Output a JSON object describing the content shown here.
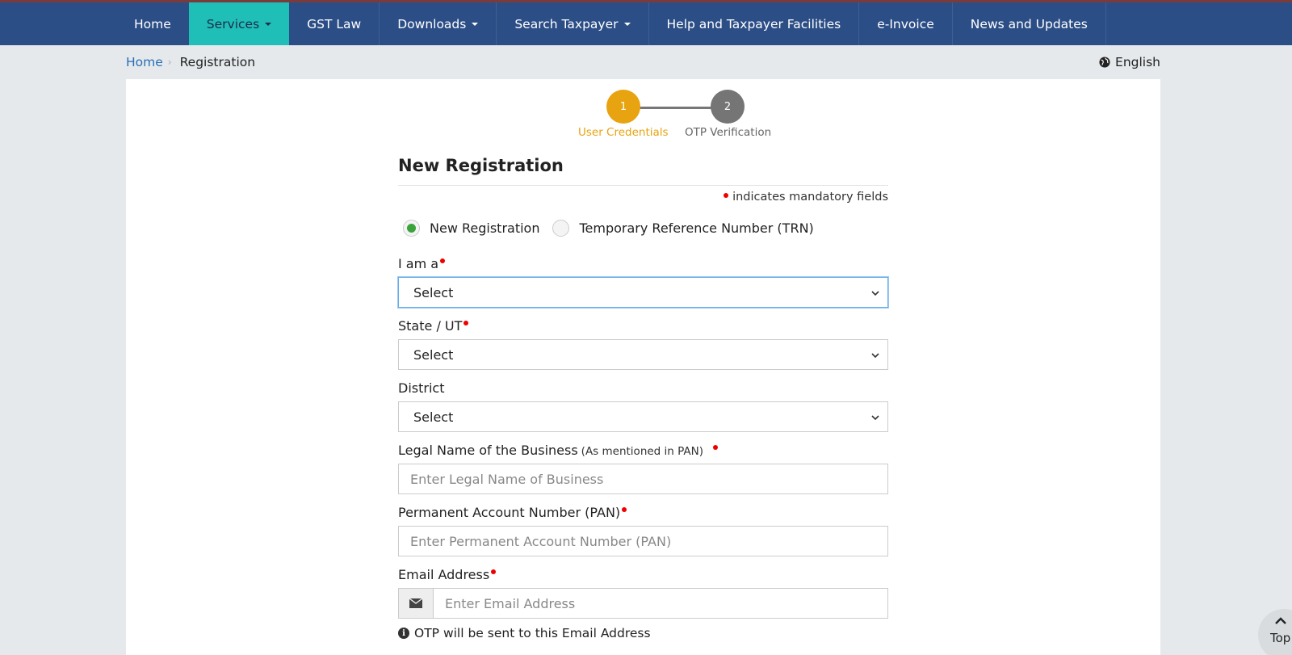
{
  "nav": {
    "items": [
      {
        "label": "Home",
        "dropdown": false
      },
      {
        "label": "Services",
        "dropdown": true,
        "active": true
      },
      {
        "label": "GST Law",
        "dropdown": false
      },
      {
        "label": "Downloads",
        "dropdown": true
      },
      {
        "label": "Search Taxpayer",
        "dropdown": true
      },
      {
        "label": "Help and Taxpayer Facilities",
        "dropdown": false
      },
      {
        "label": "e-Invoice",
        "dropdown": false
      },
      {
        "label": "News and Updates",
        "dropdown": false
      }
    ]
  },
  "breadcrumb": {
    "home": "Home",
    "current": "Registration"
  },
  "language": {
    "label": "English",
    "icon": "globe-icon"
  },
  "stepper": {
    "steps": [
      {
        "number": "1",
        "label": "User Credentials",
        "state": "active",
        "color": "#e8a310"
      },
      {
        "number": "2",
        "label": "OTP Verification",
        "state": "pending",
        "color": "#757575"
      }
    ]
  },
  "form": {
    "title": "New Registration",
    "mandatory_note": "indicates mandatory fields",
    "radio": {
      "options": [
        "New Registration",
        "Temporary Reference Number (TRN)"
      ],
      "selected": "New Registration"
    },
    "i_am_a": {
      "label": "I am a",
      "value": "Select"
    },
    "state": {
      "label": "State / UT",
      "value": "Select"
    },
    "district": {
      "label": "District",
      "value": "Select"
    },
    "legal_name": {
      "label": "Legal Name of the Business",
      "sub": "(As mentioned in PAN)",
      "placeholder": "Enter Legal Name of Business"
    },
    "pan": {
      "label": "Permanent Account Number (PAN)",
      "placeholder": "Enter Permanent Account Number (PAN)"
    },
    "email": {
      "label": "Email Address",
      "placeholder": "Enter Email Address",
      "icon": "envelope-icon"
    },
    "email_hint": "OTP will be sent to this Email Address"
  },
  "scroll_top": {
    "label": "Top"
  },
  "colors": {
    "navbar": "#2c4e86",
    "nav_active": "#1fbfb8",
    "step_active": "#e8a310",
    "required_dot": "#ee0000"
  }
}
